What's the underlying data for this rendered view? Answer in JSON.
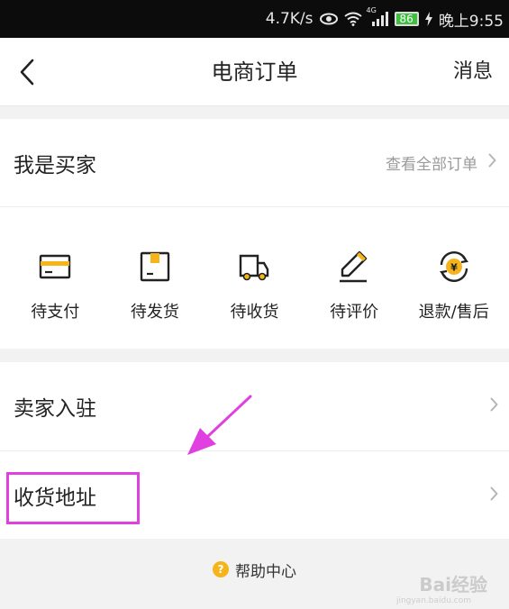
{
  "status_bar": {
    "net_speed": "4.7K/s",
    "signal_type": "4G",
    "battery": "86",
    "time": "晚上9:55"
  },
  "header": {
    "title": "电商订单",
    "messages": "消息"
  },
  "buyer": {
    "title": "我是买家",
    "view_all": "查看全部订单",
    "orders": [
      {
        "label": "待支付",
        "icon": "card-icon"
      },
      {
        "label": "待发货",
        "icon": "package-icon"
      },
      {
        "label": "待收货",
        "icon": "truck-icon"
      },
      {
        "label": "待评价",
        "icon": "pencil-icon"
      },
      {
        "label": "退款/售后",
        "icon": "refund-icon"
      }
    ]
  },
  "list": {
    "seller": "卖家入驻",
    "address": "收货地址"
  },
  "help": {
    "label": "帮助中心",
    "badge": "?"
  },
  "watermark": {
    "text": "Bai经验",
    "sub": "jingyan.baidu.com"
  },
  "colors": {
    "accent_yellow": "#f5b51a",
    "highlight_magenta": "#e040e0",
    "background": "#f2f2f2"
  }
}
